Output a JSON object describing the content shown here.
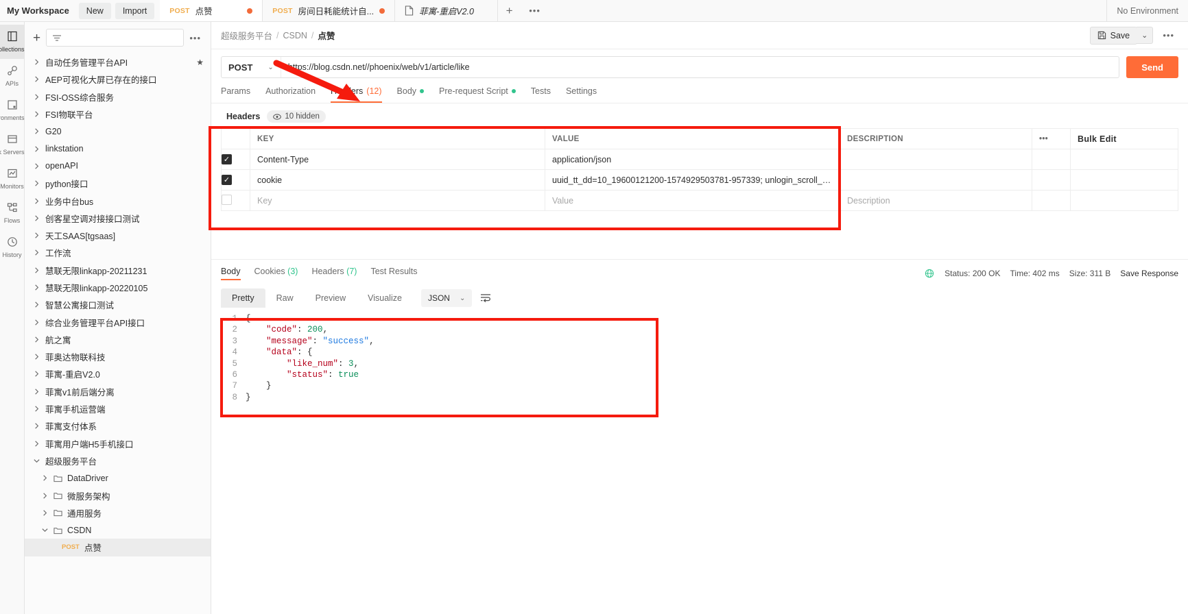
{
  "app": {
    "workspace": "My Workspace",
    "new_label": "New",
    "import_label": "Import",
    "environment": "No Environment",
    "tab_add": "+",
    "tab_more": "•••"
  },
  "tabs": [
    {
      "method": "POST",
      "title": "点赞",
      "dirty": true,
      "active": true,
      "italic": false,
      "icon": ""
    },
    {
      "method": "POST",
      "title": "房间日耗能统计自...",
      "dirty": true,
      "active": false,
      "italic": false,
      "icon": ""
    },
    {
      "method": "",
      "title": "菲寓-重启V2.0",
      "dirty": false,
      "active": false,
      "italic": true,
      "icon": "document-icon"
    }
  ],
  "rail": [
    {
      "label": "Collections",
      "icon": "collections-icon",
      "active": true
    },
    {
      "label": "APIs",
      "icon": "apis-icon",
      "active": false
    },
    {
      "label": "Environments",
      "icon": "environments-icon",
      "active": false
    },
    {
      "label": "Mock Servers",
      "icon": "mock-servers-icon",
      "active": false
    },
    {
      "label": "Monitors",
      "icon": "monitors-icon",
      "active": false
    },
    {
      "label": "Flows",
      "icon": "flows-icon",
      "active": false
    },
    {
      "label": "History",
      "icon": "history-icon",
      "active": false
    }
  ],
  "sidebar": {
    "filter_placeholder": "",
    "more_label": "•••",
    "items": [
      {
        "label": "自动任务管理平台API",
        "depth": 0,
        "expanded": false,
        "folder": false,
        "starred": true
      },
      {
        "label": "AEP可视化大屏已存在的接口",
        "depth": 0,
        "expanded": false,
        "folder": false,
        "starred": false
      },
      {
        "label": "FSI-OSS综合服务",
        "depth": 0,
        "expanded": false,
        "folder": false,
        "starred": false
      },
      {
        "label": "FSI物联平台",
        "depth": 0,
        "expanded": false,
        "folder": false,
        "starred": false
      },
      {
        "label": "G20",
        "depth": 0,
        "expanded": false,
        "folder": false,
        "starred": false
      },
      {
        "label": "linkstation",
        "depth": 0,
        "expanded": false,
        "folder": false,
        "starred": false
      },
      {
        "label": "openAPI",
        "depth": 0,
        "expanded": false,
        "folder": false,
        "starred": false
      },
      {
        "label": "python接口",
        "depth": 0,
        "expanded": false,
        "folder": false,
        "starred": false
      },
      {
        "label": "业务中台bus",
        "depth": 0,
        "expanded": false,
        "folder": false,
        "starred": false
      },
      {
        "label": "创客星空调对接接口测试",
        "depth": 0,
        "expanded": false,
        "folder": false,
        "starred": false
      },
      {
        "label": "天工SAAS[tgsaas]",
        "depth": 0,
        "expanded": false,
        "folder": false,
        "starred": false
      },
      {
        "label": "工作流",
        "depth": 0,
        "expanded": false,
        "folder": false,
        "starred": false
      },
      {
        "label": "慧联无限linkapp-20211231",
        "depth": 0,
        "expanded": false,
        "folder": false,
        "starred": false
      },
      {
        "label": "慧联无限linkapp-20220105",
        "depth": 0,
        "expanded": false,
        "folder": false,
        "starred": false
      },
      {
        "label": "智慧公寓接口测试",
        "depth": 0,
        "expanded": false,
        "folder": false,
        "starred": false
      },
      {
        "label": "综合业务管理平台API接口",
        "depth": 0,
        "expanded": false,
        "folder": false,
        "starred": false
      },
      {
        "label": "航之寓",
        "depth": 0,
        "expanded": false,
        "folder": false,
        "starred": false
      },
      {
        "label": "菲奥达物联科技",
        "depth": 0,
        "expanded": false,
        "folder": false,
        "starred": false
      },
      {
        "label": "菲寓-重启V2.0",
        "depth": 0,
        "expanded": false,
        "folder": false,
        "starred": false
      },
      {
        "label": "菲寓v1前后端分离",
        "depth": 0,
        "expanded": false,
        "folder": false,
        "starred": false
      },
      {
        "label": "菲寓手机运营端",
        "depth": 0,
        "expanded": false,
        "folder": false,
        "starred": false
      },
      {
        "label": "菲寓支付体系",
        "depth": 0,
        "expanded": false,
        "folder": false,
        "starred": false
      },
      {
        "label": "菲寓用户端H5手机接口",
        "depth": 0,
        "expanded": false,
        "folder": false,
        "starred": false
      },
      {
        "label": "超级服务平台",
        "depth": 0,
        "expanded": true,
        "folder": false,
        "starred": false
      },
      {
        "label": "DataDriver",
        "depth": 1,
        "expanded": false,
        "folder": true,
        "starred": false
      },
      {
        "label": "微服务架构",
        "depth": 1,
        "expanded": false,
        "folder": true,
        "starred": false
      },
      {
        "label": "通用服务",
        "depth": 1,
        "expanded": false,
        "folder": true,
        "starred": false
      },
      {
        "label": "CSDN",
        "depth": 1,
        "expanded": true,
        "folder": true,
        "starred": false
      },
      {
        "label": "点赞",
        "depth": 2,
        "expanded": false,
        "folder": false,
        "starred": false,
        "method": "POST",
        "selected": true
      }
    ]
  },
  "breadcrumb": {
    "parts": [
      "超级服务平台",
      "CSDN",
      "点赞"
    ],
    "sep": "/",
    "save_label": "Save",
    "save_caret": "⌄",
    "more_label": "•••"
  },
  "request": {
    "method": "POST",
    "method_caret": "⌄",
    "url": "https://blog.csdn.net//phoenix/web/v1/article/like",
    "send_label": "Send",
    "tabs": [
      {
        "label": "Params",
        "active": false,
        "count": "",
        "dot": false
      },
      {
        "label": "Authorization",
        "active": false,
        "count": "",
        "dot": false
      },
      {
        "label": "Headers",
        "active": true,
        "count": "(12)",
        "dot": false
      },
      {
        "label": "Body",
        "active": false,
        "count": "",
        "dot": true
      },
      {
        "label": "Pre-request Script",
        "active": false,
        "count": "",
        "dot": true
      },
      {
        "label": "Tests",
        "active": false,
        "count": "",
        "dot": false
      },
      {
        "label": "Settings",
        "active": false,
        "count": "",
        "dot": false
      }
    ],
    "headers_section_title": "Headers",
    "hidden_label": "10 hidden",
    "bulk_edit_label": "Bulk Edit",
    "row_more": "•••",
    "columns": [
      "KEY",
      "VALUE",
      "DESCRIPTION"
    ],
    "rows": [
      {
        "checked": true,
        "key": "Content-Type",
        "value": "application/json",
        "description": ""
      },
      {
        "checked": true,
        "key": "cookie",
        "value": "uuid_tt_dd=10_19600121200-1574929503781-957339; unlogin_scroll_step",
        "description": ""
      }
    ],
    "new_row": {
      "key_placeholder": "Key",
      "value_placeholder": "Value",
      "desc_placeholder": "Description"
    }
  },
  "response": {
    "tabs": [
      {
        "label": "Body",
        "count": "",
        "active": true
      },
      {
        "label": "Cookies",
        "count": "(3)",
        "active": false
      },
      {
        "label": "Headers",
        "count": "(7)",
        "active": false
      },
      {
        "label": "Test Results",
        "count": "",
        "active": false
      }
    ],
    "status": "Status: 200 OK",
    "time": "Time: 402 ms",
    "size": "Size: 311 B",
    "save_response": "Save Response",
    "view_tabs": [
      {
        "label": "Pretty",
        "active": true
      },
      {
        "label": "Raw",
        "active": false
      },
      {
        "label": "Preview",
        "active": false
      },
      {
        "label": "Visualize",
        "active": false
      }
    ],
    "format": "JSON",
    "format_caret": "⌄",
    "line_numbers": [
      "1",
      "2",
      "3",
      "4",
      "5",
      "6",
      "7",
      "8"
    ],
    "body_text": "{\n    \"code\": 200,\n    \"message\": \"success\",\n    \"data\": {\n        \"like_num\": 3,\n        \"status\": true\n    }\n}",
    "body_lines": [
      {
        "indent": 0,
        "tokens": [
          {
            "t": "{",
            "c": "pn"
          }
        ]
      },
      {
        "indent": 1,
        "tokens": [
          {
            "t": "\"code\"",
            "c": "k"
          },
          {
            "t": ": ",
            "c": "pn"
          },
          {
            "t": "200",
            "c": "num"
          },
          {
            "t": ",",
            "c": "pn"
          }
        ]
      },
      {
        "indent": 1,
        "tokens": [
          {
            "t": "\"message\"",
            "c": "k"
          },
          {
            "t": ": ",
            "c": "pn"
          },
          {
            "t": "\"success\"",
            "c": "str"
          },
          {
            "t": ",",
            "c": "pn"
          }
        ]
      },
      {
        "indent": 1,
        "tokens": [
          {
            "t": "\"data\"",
            "c": "k"
          },
          {
            "t": ": {",
            "c": "pn"
          }
        ]
      },
      {
        "indent": 2,
        "tokens": [
          {
            "t": "\"like_num\"",
            "c": "k"
          },
          {
            "t": ": ",
            "c": "pn"
          },
          {
            "t": "3",
            "c": "num"
          },
          {
            "t": ",",
            "c": "pn"
          }
        ]
      },
      {
        "indent": 2,
        "tokens": [
          {
            "t": "\"status\"",
            "c": "k"
          },
          {
            "t": ": ",
            "c": "pn"
          },
          {
            "t": "true",
            "c": "bool"
          }
        ]
      },
      {
        "indent": 1,
        "tokens": [
          {
            "t": "}",
            "c": "pn"
          }
        ]
      },
      {
        "indent": 0,
        "tokens": [
          {
            "t": "}",
            "c": "pn"
          }
        ]
      }
    ]
  },
  "annotations": {
    "headers_highlight_color": "#f51b0e",
    "code_highlight_color": "#f51b0e",
    "arrow_color": "#f51b0e",
    "arrow_target": "Headers (12)"
  },
  "colors": {
    "accent": "#ff6c37",
    "method": "#f0ad4e",
    "success": "#31c48d",
    "annotation": "#f51b0e"
  }
}
